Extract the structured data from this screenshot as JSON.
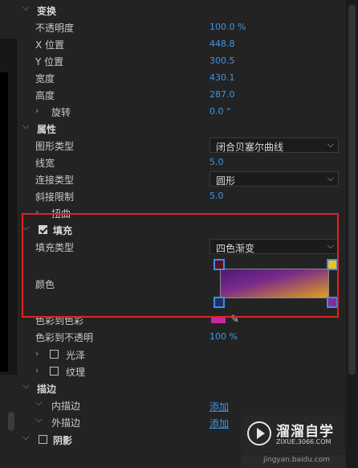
{
  "sections": {
    "transform": {
      "title": "变换"
    },
    "properties": {
      "title": "属性"
    },
    "fill": {
      "title": "填充",
      "checked": true
    },
    "stroke": {
      "title": "描边"
    },
    "shadow": {
      "title": "阴影"
    }
  },
  "transform_rows": [
    {
      "label": "不透明度",
      "value": "100.0 %"
    },
    {
      "label": "X 位置",
      "value": "448.8"
    },
    {
      "label": "Y 位置",
      "value": "300.5"
    },
    {
      "label": "宽度",
      "value": "430.1"
    },
    {
      "label": "高度",
      "value": "287.0"
    },
    {
      "label": "旋转",
      "value": "0.0 °"
    }
  ],
  "properties_rows": {
    "shape_type": {
      "label": "图形类型",
      "value": "闭合贝塞尔曲线"
    },
    "line_width": {
      "label": "线宽",
      "value": "5.0"
    },
    "join_type": {
      "label": "连接类型",
      "value": "圆形"
    },
    "miter_limit": {
      "label": "斜接限制",
      "value": "5.0"
    },
    "twist": {
      "label": "扭曲"
    }
  },
  "fill_rows": {
    "fill_type": {
      "label": "填充类型",
      "value": "四色渐变"
    },
    "color": {
      "label": "颜色"
    },
    "color_to_color": {
      "label": "色彩到色彩"
    },
    "color_to_opacity": {
      "label": "色彩到不透明",
      "value": "100 %"
    },
    "gloss": {
      "label": "光泽"
    },
    "texture": {
      "label": "纹理"
    }
  },
  "stroke_rows": {
    "inner": {
      "label": "内描边",
      "action": "添加"
    },
    "outer": {
      "label": "外描边",
      "action": "添加"
    }
  },
  "colors": {
    "accent": "#3f96e6",
    "highlight_box": "#e02323",
    "gradient_top_left": "#4a1a7a",
    "gradient_bottom_right": "#e0a020",
    "stop_top_left": "#5a1020",
    "stop_top_right": "#f0c020",
    "stop_bottom_left": "#203060",
    "stop_bottom_right": "#8a2aa0",
    "swatch": "#c42a9c"
  },
  "watermark": {
    "name": "溜溜自学",
    "url": "ZIXUE.3066.COM"
  },
  "bottom_fragment": "jingyan.baidu.com"
}
